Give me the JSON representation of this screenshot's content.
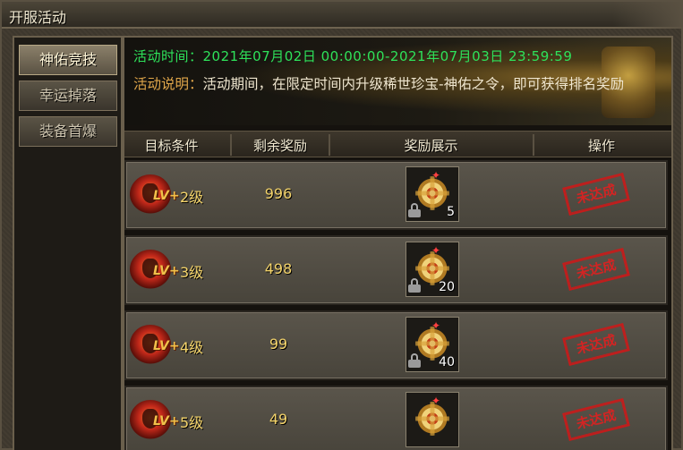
{
  "window": {
    "title": "开服活动"
  },
  "sidebar": {
    "tabs": [
      {
        "label": "神佑竞技",
        "active": true
      },
      {
        "label": "幸运掉落",
        "active": false
      },
      {
        "label": "装备首爆",
        "active": false
      }
    ]
  },
  "banner": {
    "time_line": "活动时间：2021年07月02日 00:00:00-2021年07月03日 23:59:59",
    "desc_label": "活动说明：",
    "desc_text": "活动期间，在限定时间内升级稀世珍宝-神佑之令，即可获得排名奖励"
  },
  "table": {
    "headers": [
      "目标条件",
      "剩余奖励",
      "奖励展示",
      "操作"
    ],
    "badge_text": "LV+",
    "rows": [
      {
        "level": "2级",
        "remain": "996",
        "reward_count": "5",
        "status": "未达成"
      },
      {
        "level": "3级",
        "remain": "498",
        "reward_count": "20",
        "status": "未达成"
      },
      {
        "level": "4级",
        "remain": "99",
        "reward_count": "40",
        "status": "未达成"
      },
      {
        "level": "5级",
        "remain": "49",
        "reward_count": "",
        "status": "未达成"
      }
    ]
  },
  "colors": {
    "time_green": "#2ee25a",
    "desc_label_orange": "#e0a64a",
    "value_gold": "#f3d36a",
    "stamp_red": "#e02020"
  },
  "icons": {
    "reward_item": "golden-gear-seal-icon",
    "lock": "lock-icon",
    "level_badge": "flame-demon-badge-icon"
  }
}
